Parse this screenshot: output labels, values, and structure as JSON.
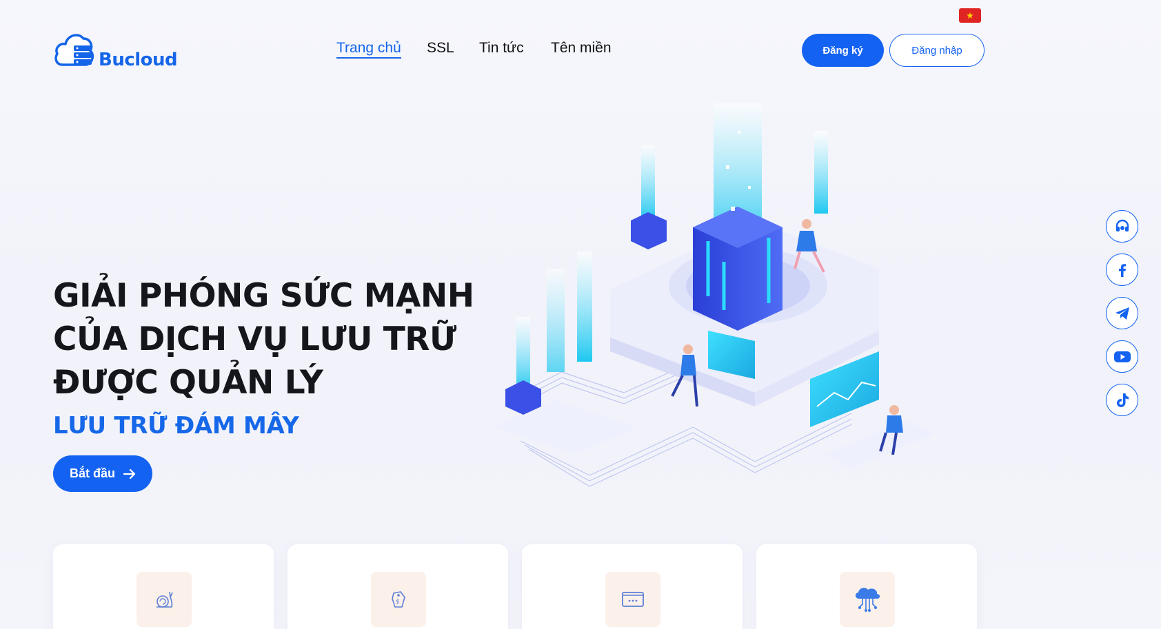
{
  "brand": {
    "name": "Bucloud",
    "color": "#1565e8"
  },
  "language": {
    "flag": "vietnam-flag"
  },
  "nav": {
    "items": [
      {
        "label": "Trang chủ",
        "active": true
      },
      {
        "label": "SSL",
        "active": false
      },
      {
        "label": "Tin tức",
        "active": false
      },
      {
        "label": "Tên miền",
        "active": false
      }
    ]
  },
  "auth": {
    "register_label": "Đăng ký",
    "login_label": "Đăng nhập"
  },
  "hero": {
    "title_lines": [
      "GIẢI PHÓNG SỨC MẠNH",
      "CỦA DỊCH VỤ LƯU TRỮ",
      "ĐƯỢC QUẢN LÝ"
    ],
    "subtitle": "LƯU TRỮ ĐÁM MÂY",
    "cta_label": "Bắt đầu",
    "cta_icon": "arrow-right-icon"
  },
  "social": [
    {
      "name": "support-headset-icon"
    },
    {
      "name": "facebook-icon"
    },
    {
      "name": "telegram-icon"
    },
    {
      "name": "youtube-icon"
    },
    {
      "name": "tiktok-icon"
    }
  ],
  "features": [
    {
      "icon": "snail-icon"
    },
    {
      "icon": "price-tag-icon"
    },
    {
      "icon": "terminal-window-icon"
    },
    {
      "icon": "cloud-network-icon"
    }
  ],
  "colors": {
    "primary": "#1462f1",
    "accent": "#1668e8",
    "card_icon_bg": "#fbf0ea"
  }
}
